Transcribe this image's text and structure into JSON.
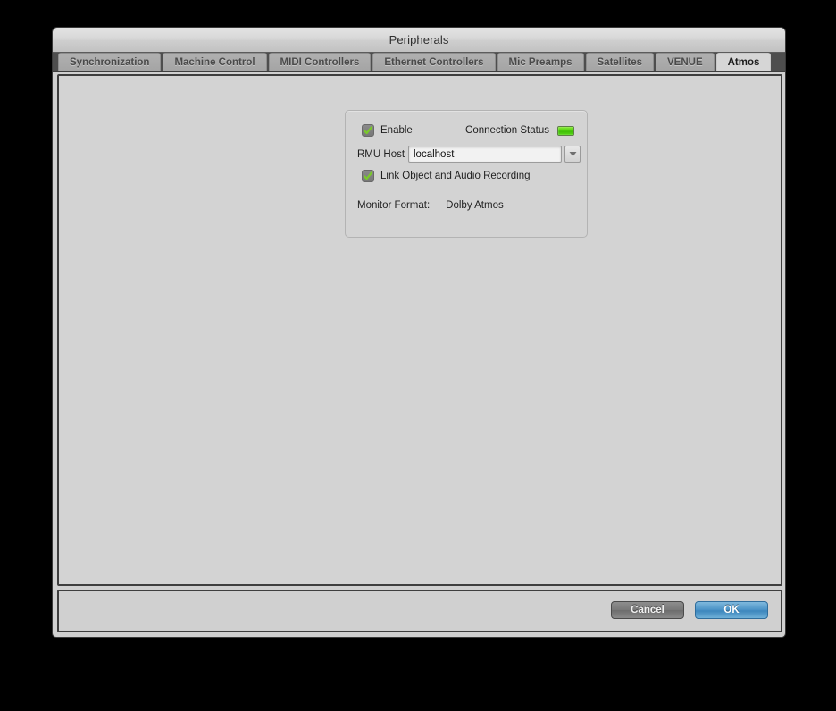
{
  "window": {
    "title": "Peripherals"
  },
  "tabs": [
    {
      "id": "synchronization",
      "label": "Synchronization",
      "selected": false
    },
    {
      "id": "machine-control",
      "label": "Machine Control",
      "selected": false
    },
    {
      "id": "midi-controllers",
      "label": "MIDI Controllers",
      "selected": false
    },
    {
      "id": "ethernet-controllers",
      "label": "Ethernet Controllers",
      "selected": false
    },
    {
      "id": "mic-preamps",
      "label": "Mic Preamps",
      "selected": false
    },
    {
      "id": "satellites",
      "label": "Satellites",
      "selected": false
    },
    {
      "id": "venue",
      "label": "VENUE",
      "selected": false
    },
    {
      "id": "atmos",
      "label": "Atmos",
      "selected": true
    }
  ],
  "atmos_panel": {
    "enable": {
      "label": "Enable",
      "checked": true,
      "checkmark_color": "#7ac92b"
    },
    "connection_status": {
      "label": "Connection Status",
      "state_color": "#4fd40d"
    },
    "rmu_host": {
      "label": "RMU Host",
      "value": "localhost",
      "placeholder": "localhost",
      "dropdown_icon": "chevron-down-icon"
    },
    "link_recording": {
      "label": "Link Object and Audio Recording",
      "checked": true
    },
    "monitor_format": {
      "label": "Monitor Format:",
      "value": "Dolby Atmos"
    }
  },
  "footer": {
    "cancel_label": "Cancel",
    "ok_label": "OK",
    "ok_accent_color": "#4f96c8"
  }
}
